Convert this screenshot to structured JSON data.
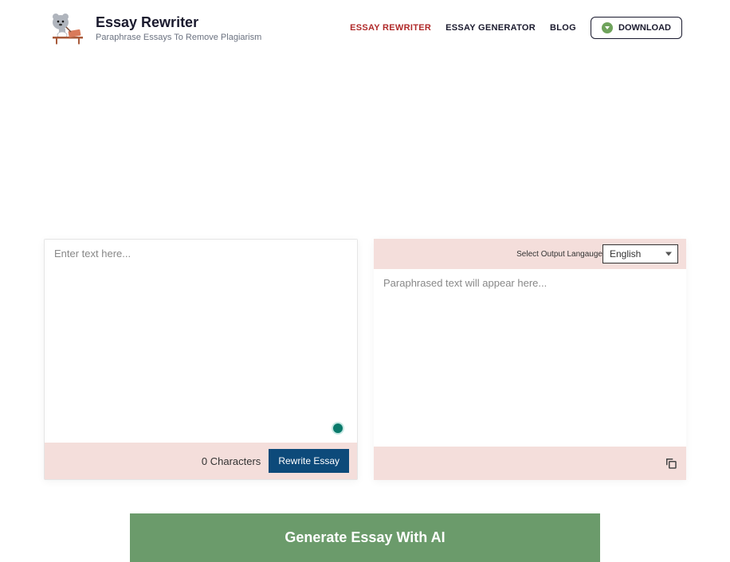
{
  "header": {
    "title": "Essay Rewriter",
    "tagline": "Paraphrase Essays To Remove Plagiarism"
  },
  "nav": {
    "rewriter": "ESSAY REWRITER",
    "generator": "ESSAY GENERATOR",
    "blog": "BLOG",
    "download": "DOWNLOAD"
  },
  "input": {
    "placeholder": "Enter text here...",
    "char_label": "0 Characters",
    "rewrite_btn": "Rewrite Essay"
  },
  "output": {
    "lang_label": "Select Output Langauge",
    "lang_selected": "English",
    "placeholder": "Paraphrased text will appear here..."
  },
  "cta": {
    "generate": "Generate Essay With AI"
  }
}
